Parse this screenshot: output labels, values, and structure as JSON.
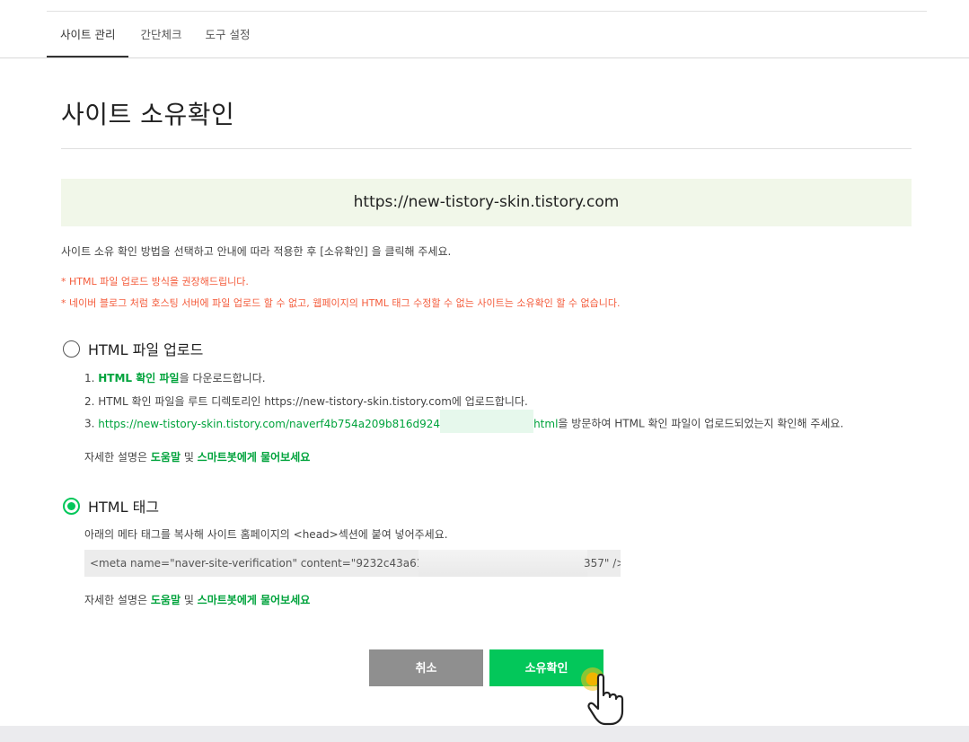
{
  "tabs": [
    {
      "label": "사이트 관리",
      "active": true
    },
    {
      "label": "간단체크",
      "active": false
    },
    {
      "label": "도구 설정",
      "active": false
    }
  ],
  "page_title": "사이트 소유확인",
  "site_url": "https://new-tistory-skin.tistory.com",
  "description": "사이트 소유 확인 방법을 선택하고 안내에 따라 적용한 후 [소유확인] 을 클릭해 주세요.",
  "warnings": [
    "* HTML 파일 업로드 방식을 권장해드립니다.",
    "* 네이버 블로그 처럼 호스팅 서버에 파일 업로드 할 수 없고, 웹페이지의 HTML 태그 수정할 수 없는 사이트는 소유확인 할 수 없습니다."
  ],
  "option_file": {
    "label": "HTML 파일 업로드",
    "selected": false,
    "step1_prefix": "1. ",
    "step1_link": "HTML 확인 파일",
    "step1_suffix": "을 다운로드합니다.",
    "step2": "2. HTML 확인 파일을 루트 디렉토리인 https://new-tistory-skin.tistory.com에 업로드합니다.",
    "step3_prefix": "3. ",
    "step3_link": "https://new-tistory-skin.tistory.com/naverf4b754a209b816d924",
    "step3_link_end": "html",
    "step3_suffix": "을 방문하여 HTML 확인 파일이 업로드되었는지 확인해 주세요."
  },
  "help": {
    "prefix": "자세한 설명은 ",
    "link1": "도움말",
    "middle": " 및 ",
    "link2": "스마트봇에게 물어보세요"
  },
  "option_tag": {
    "label": "HTML 태그",
    "selected": true,
    "instruction": "아래의 메타 태그를 복사해 사이트 홈페이지의 <head>섹션에 붙여 넣어주세요.",
    "meta_start": "<meta name=\"naver-site-verification\" content=\"9232c43a611e",
    "meta_end": "357\" />"
  },
  "buttons": {
    "cancel": "취소",
    "confirm": "소유확인"
  },
  "colors": {
    "accent": "#03c75a",
    "link": "#00a33c",
    "warning": "#f45b3b",
    "url_box_bg": "#f1f7e9",
    "cancel_bg": "#8f8f8f"
  },
  "icons": {
    "cursor": "hand-pointer-icon"
  }
}
